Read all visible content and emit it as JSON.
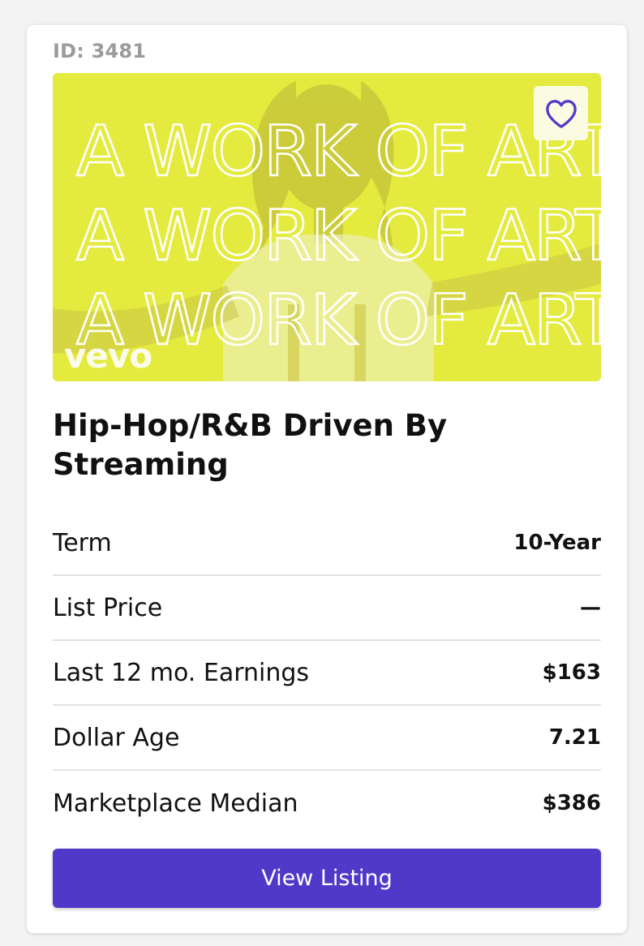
{
  "listing": {
    "id_label": "ID: 3481",
    "title": "Hip-Hop/R&B Driven By Streaming",
    "favorite_icon": "heart-icon"
  },
  "thumbnail": {
    "text_lines": [
      "A WORK OF ART",
      "A WORK OF ART",
      "A WORK OF ART"
    ],
    "watermark": "vevo",
    "background_color": "#e4ea3e"
  },
  "stats": [
    {
      "label": "Term",
      "value": "10-Year"
    },
    {
      "label": "List Price",
      "value": "—"
    },
    {
      "label": "Last 12 mo. Earnings",
      "value": "$163"
    },
    {
      "label": "Dollar Age",
      "value": "7.21"
    },
    {
      "label": "Marketplace Median",
      "value": "$386"
    }
  ],
  "actions": {
    "view_label": "View Listing"
  },
  "colors": {
    "primary": "#5039c9",
    "muted_text": "#9b9b9b",
    "divider": "#e2e2e2"
  }
}
